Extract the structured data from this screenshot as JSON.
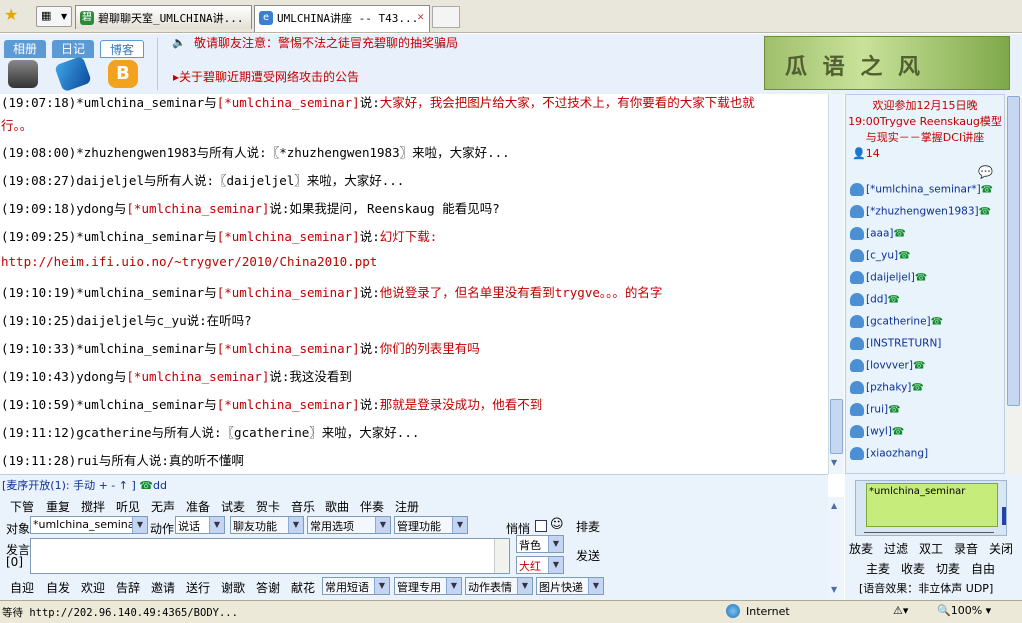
{
  "browser": {
    "tabs": [
      {
        "label": "碧聊聊天室_UMLCHINA讲...",
        "active": false
      },
      {
        "label": "UMLCHINA讲座 -- T43...",
        "active": true
      }
    ]
  },
  "toolbar": {
    "tabs": [
      "相册",
      "日记",
      "博客"
    ],
    "notice_top": "敬请聊友注意：警惕不法之徒冒充碧聊的抽奖骗局",
    "notice_bottom": "关于碧聊近期遭受网络攻击的公告"
  },
  "chat": {
    "lines": [
      {
        "prefix": "(19:07:18)*umlchina_seminar与",
        "to": "[*umlchina_seminar]",
        "said": "说:",
        "msg": "大家好，我会把图片给大家，不过技术上，有你要看的大家下载也就"
      },
      {
        "prefix": "",
        "to": "",
        "said": "",
        "msg": "行。。"
      },
      {
        "prefix": "(19:08:00)*zhuzhengwen1983与所有人说:〖*zhuzhengwen1983〗来啦，大家好...",
        "to": "",
        "said": "",
        "msg": ""
      },
      {
        "prefix": "(19:08:27)daijeljel与所有人说:〖daijeljel〗来啦，大家好...",
        "to": "",
        "said": "",
        "msg": ""
      },
      {
        "prefix": "(19:09:18)ydong与",
        "to": "[*umlchina_seminar]",
        "said": "说:如果我提问, Reenskaug 能看见吗?",
        "msg": ""
      },
      {
        "prefix": "(19:09:25)*umlchina_seminar与",
        "to": "[*umlchina_seminar]",
        "said": "说:",
        "msg": "幻灯下载:"
      },
      {
        "prefix": "",
        "to": "",
        "said": "",
        "msg": "http://heim.ifi.uio.no/~trygver/2010/China2010.ppt"
      },
      {
        "prefix": "(19:10:19)*umlchina_seminar与",
        "to": "[*umlchina_seminar]",
        "said": "说:",
        "msg": "他说登录了，但名单里没有看到trygve。。。的名字"
      },
      {
        "prefix": "(19:10:25)daijeljel与c_yu说:在听吗?",
        "to": "",
        "said": "",
        "msg": ""
      },
      {
        "prefix": "(19:10:33)*umlchina_seminar与",
        "to": "[*umlchina_seminar]",
        "said": "说:",
        "msg": "你们的列表里有吗"
      },
      {
        "prefix": "(19:10:43)ydong与",
        "to": "[*umlchina_seminar]",
        "said": "说:我这没看到",
        "msg": ""
      },
      {
        "prefix": "(19:10:59)*umlchina_seminar与",
        "to": "[*umlchina_seminar]",
        "said": "说:",
        "msg": "那就是登录没成功，他看不到"
      },
      {
        "prefix": "(19:11:12)gcatherine与所有人说:〖gcatherine〗来啦，大家好...",
        "to": "",
        "said": "",
        "msg": ""
      },
      {
        "prefix": "(19:11:28)rui与所有人说:真的听不懂啊",
        "to": "",
        "said": "",
        "msg": ""
      }
    ]
  },
  "sidebar": {
    "welcome": "欢迎参加12月15日晚19:00Trygve Reenskaug模型与现实－－掌握DCI讲座",
    "count": "14",
    "users": [
      "[*umlchina_seminar*]",
      "[*zhuzhengwen1983]",
      "[aaa]",
      "[c_yu]",
      "[daijeljel]",
      "[dd]",
      "[gcatherine]",
      "[INSTRETURN]",
      "[lovvver]",
      "[pzhaky]",
      "[rui]",
      "[wyl]",
      "[xiaozhang]"
    ],
    "phone_flags": [
      true,
      true,
      true,
      true,
      true,
      true,
      true,
      false,
      true,
      true,
      true,
      true,
      false
    ]
  },
  "bottom": {
    "mic_status": "[麦序开放(1): 手动 + - ↑ ]",
    "mic_user": "dd",
    "actions": [
      "下管",
      "重复",
      "搅拌",
      "听见",
      "无声",
      "准备",
      "试麦",
      "贺卡",
      "音乐",
      "歌曲",
      "伴奏",
      "注册"
    ],
    "target_label": "对象",
    "target_value": "*umlchina_semina",
    "action_label": "动作",
    "action_value": "说话",
    "dropdowns_row1": [
      "聊友功能",
      "常用选项",
      "管理功能"
    ],
    "whisper": "悄悄",
    "queue_btn": "排麦",
    "speak_label": "发言",
    "speak_count": "[0]",
    "bg_color": "背色",
    "font_color": "大红",
    "send_btn": "发送",
    "row3": [
      "自迎",
      "自发",
      "欢迎",
      "告辞",
      "邀请",
      "送行",
      "谢歌",
      "答谢",
      "献花"
    ],
    "row3_selects": [
      "常用短语",
      "管理专用",
      "动作表情",
      "图片快递"
    ]
  },
  "rightbottom": {
    "speaker": "*umlchina_seminar",
    "btns1": [
      "放麦",
      "过滤",
      "双工",
      "录音",
      "关闭"
    ],
    "btns2": [
      "主麦",
      "收麦",
      "切麦",
      "自由"
    ],
    "effect": "[语音效果：非立体声 UDP]"
  },
  "status": {
    "url": "等待 http://202.96.140.49:4365/BODY...",
    "zone": "Internet",
    "zoom": "100%"
  }
}
